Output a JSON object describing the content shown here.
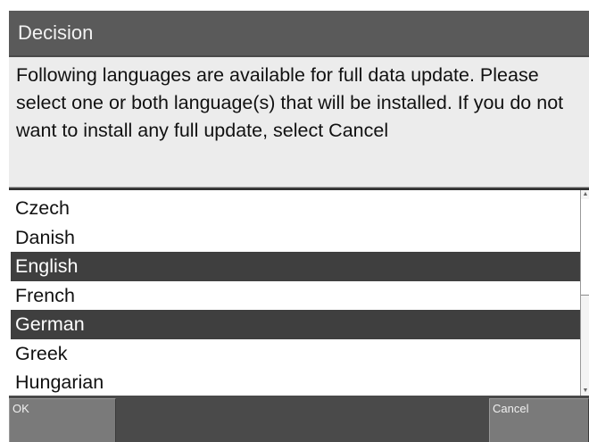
{
  "dialog": {
    "title": "Decision",
    "message": "Following languages are available for full data update. Please select one or both language(s) that will be installed. If you do not want to install any full update, select Cancel"
  },
  "languages": [
    {
      "label": "Czech",
      "selected": false
    },
    {
      "label": "Danish",
      "selected": false
    },
    {
      "label": "English",
      "selected": true
    },
    {
      "label": "French",
      "selected": false
    },
    {
      "label": "German",
      "selected": true
    },
    {
      "label": "Greek",
      "selected": false
    },
    {
      "label": "Hungarian",
      "selected": false
    }
  ],
  "buttons": {
    "ok_label": "OK",
    "cancel_label": "Cancel"
  },
  "colors": {
    "selection_background": "#3f3f3f",
    "title_background": "#5a5a5a",
    "message_background": "#ececec"
  },
  "icons": {
    "scroll_up": "scroll-up-arrow-icon",
    "scroll_down": "scroll-down-arrow-icon"
  }
}
